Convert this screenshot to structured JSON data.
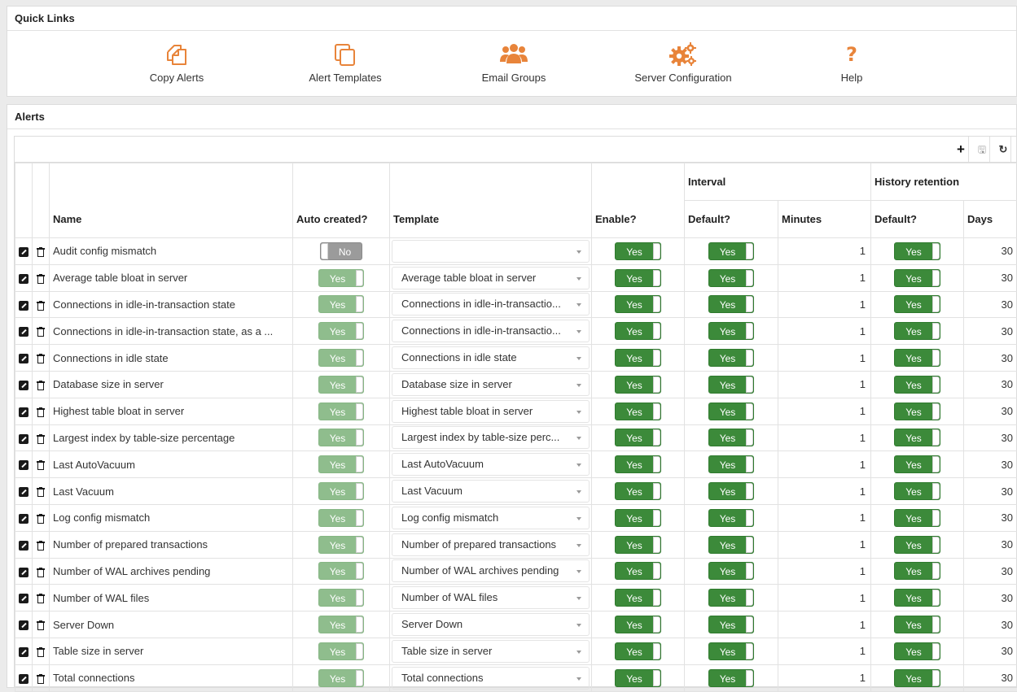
{
  "quick_links": {
    "title": "Quick Links",
    "items": [
      {
        "label": "Copy Alerts",
        "icon": "copy-alerts-icon"
      },
      {
        "label": "Alert Templates",
        "icon": "alert-templates-icon"
      },
      {
        "label": "Email Groups",
        "icon": "email-groups-icon"
      },
      {
        "label": "Server Configuration",
        "icon": "server-configuration-icon"
      },
      {
        "label": "Help",
        "icon": "help-icon",
        "glyph": "?"
      }
    ],
    "accent_color": "#e8843a"
  },
  "alerts": {
    "title": "Alerts",
    "toolbar": {
      "add": "+",
      "save": "🖫",
      "refresh": "↻"
    },
    "headers": {
      "name": "Name",
      "auto_created": "Auto created?",
      "template": "Template",
      "enable": "Enable?",
      "interval": "Interval",
      "interval_default": "Default?",
      "interval_minutes": "Minutes",
      "history": "History retention",
      "history_default": "Default?",
      "history_days": "Days"
    },
    "rows": [
      {
        "name": "Audit config mismatch",
        "auto": "No",
        "template": "",
        "enable": "Yes",
        "interval_default": "Yes",
        "minutes": "1",
        "history_default": "Yes",
        "days": "30"
      },
      {
        "name": "Average table bloat in server",
        "auto": "Yes",
        "template": "Average table bloat in server",
        "enable": "Yes",
        "interval_default": "Yes",
        "minutes": "1",
        "history_default": "Yes",
        "days": "30"
      },
      {
        "name": "Connections in idle-in-transaction state",
        "auto": "Yes",
        "template": "Connections in idle-in-transactio...",
        "enable": "Yes",
        "interval_default": "Yes",
        "minutes": "1",
        "history_default": "Yes",
        "days": "30"
      },
      {
        "name": "Connections in idle-in-transaction state, as a ...",
        "auto": "Yes",
        "template": "Connections in idle-in-transactio...",
        "enable": "Yes",
        "interval_default": "Yes",
        "minutes": "1",
        "history_default": "Yes",
        "days": "30"
      },
      {
        "name": "Connections in idle state",
        "auto": "Yes",
        "template": "Connections in idle state",
        "enable": "Yes",
        "interval_default": "Yes",
        "minutes": "1",
        "history_default": "Yes",
        "days": "30"
      },
      {
        "name": "Database size in server",
        "auto": "Yes",
        "template": "Database size in server",
        "enable": "Yes",
        "interval_default": "Yes",
        "minutes": "1",
        "history_default": "Yes",
        "days": "30"
      },
      {
        "name": "Highest table bloat in server",
        "auto": "Yes",
        "template": "Highest table bloat in server",
        "enable": "Yes",
        "interval_default": "Yes",
        "minutes": "1",
        "history_default": "Yes",
        "days": "30"
      },
      {
        "name": "Largest index by table-size percentage",
        "auto": "Yes",
        "template": "Largest index by table-size perc...",
        "enable": "Yes",
        "interval_default": "Yes",
        "minutes": "1",
        "history_default": "Yes",
        "days": "30"
      },
      {
        "name": "Last AutoVacuum",
        "auto": "Yes",
        "template": "Last AutoVacuum",
        "enable": "Yes",
        "interval_default": "Yes",
        "minutes": "1",
        "history_default": "Yes",
        "days": "30"
      },
      {
        "name": "Last Vacuum",
        "auto": "Yes",
        "template": "Last Vacuum",
        "enable": "Yes",
        "interval_default": "Yes",
        "minutes": "1",
        "history_default": "Yes",
        "days": "30"
      },
      {
        "name": "Log config mismatch",
        "auto": "Yes",
        "template": "Log config mismatch",
        "enable": "Yes",
        "interval_default": "Yes",
        "minutes": "1",
        "history_default": "Yes",
        "days": "30"
      },
      {
        "name": "Number of prepared transactions",
        "auto": "Yes",
        "template": "Number of prepared transactions",
        "enable": "Yes",
        "interval_default": "Yes",
        "minutes": "1",
        "history_default": "Yes",
        "days": "30"
      },
      {
        "name": "Number of WAL archives pending",
        "auto": "Yes",
        "template": "Number of WAL archives pending",
        "enable": "Yes",
        "interval_default": "Yes",
        "minutes": "1",
        "history_default": "Yes",
        "days": "30"
      },
      {
        "name": "Number of WAL files",
        "auto": "Yes",
        "template": "Number of WAL files",
        "enable": "Yes",
        "interval_default": "Yes",
        "minutes": "1",
        "history_default": "Yes",
        "days": "30"
      },
      {
        "name": "Server Down",
        "auto": "Yes",
        "template": "Server Down",
        "enable": "Yes",
        "interval_default": "Yes",
        "minutes": "1",
        "history_default": "Yes",
        "days": "30"
      },
      {
        "name": "Table size in server",
        "auto": "Yes",
        "template": "Table size in server",
        "enable": "Yes",
        "interval_default": "Yes",
        "minutes": "1",
        "history_default": "Yes",
        "days": "30"
      },
      {
        "name": "Total connections",
        "auto": "Yes",
        "template": "Total connections",
        "enable": "Yes",
        "interval_default": "Yes",
        "minutes": "1",
        "history_default": "Yes",
        "days": "30"
      }
    ]
  },
  "colors": {
    "toggle_on": "#3c8a3a",
    "toggle_on_light": "#8fbd8d",
    "toggle_off": "#9b9b9b"
  }
}
